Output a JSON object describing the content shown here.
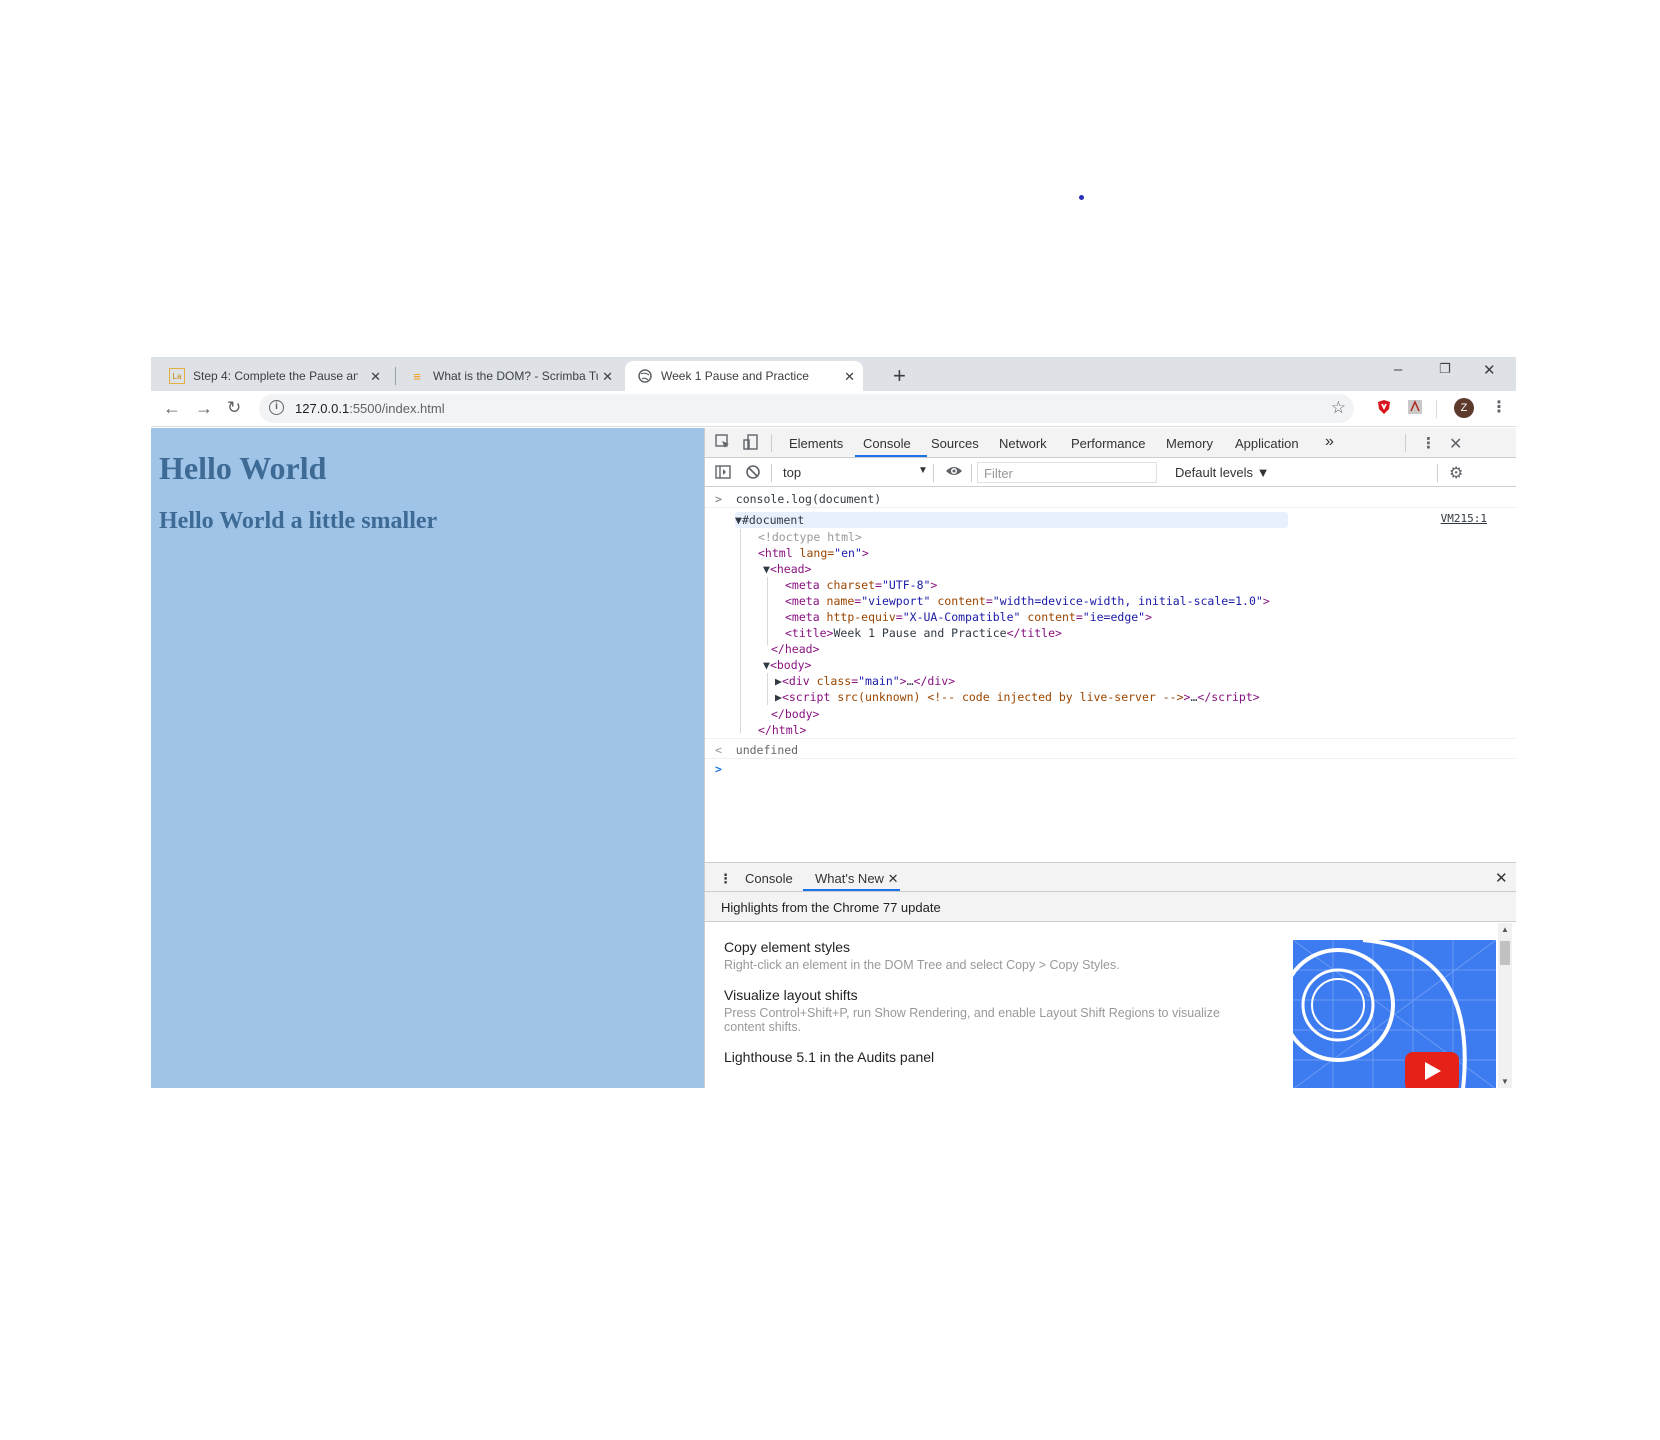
{
  "tabs": [
    {
      "title": "Step 4: Complete the Pause and Practice",
      "favicon": "la-icon"
    },
    {
      "title": "What is the DOM? - Scrimba Tutorial",
      "favicon": "scrimba-icon"
    },
    {
      "title": "Week 1 Pause and Practice",
      "favicon": "globe-icon"
    }
  ],
  "window_controls": {
    "minimize": "–",
    "restore": "❐",
    "close": "✕"
  },
  "omnibox": {
    "url_host": "127.0.0.1",
    "url_rest": ":5500/index.html"
  },
  "avatar_letter": "Z",
  "page": {
    "h1": "Hello World",
    "h2": "Hello World a little smaller"
  },
  "devtools": {
    "tabs": [
      "Elements",
      "Console",
      "Sources",
      "Network",
      "Performance",
      "Memory",
      "Application"
    ],
    "more": "»",
    "context": "top",
    "filter_placeholder": "Filter",
    "levels": "Default levels ▼",
    "source_link": "VM215:1",
    "command": "console.log(document)",
    "result": "undefined",
    "tree": {
      "document": "#document",
      "doctype": "<!doctype html>",
      "html_open_tag": "<html",
      "html_lang_attr": " lang=",
      "html_lang_val": "\"en\"",
      "head_open": "<head>",
      "meta_charset": "charset",
      "meta_charset_val": "\"UTF-8\"",
      "meta_name": "name",
      "meta_name_val": "\"viewport\"",
      "meta_content": "content",
      "meta_content_val": "\"width=device-width, initial-scale=1.0\"",
      "meta_http": "http-equiv",
      "meta_http_val": "\"X-UA-Compatible\"",
      "meta_http_content_val": "\"ie=edge\"",
      "title_text": "Week 1 Pause and Practice",
      "head_close": "</head>",
      "body_open": "<body>",
      "div_class": "class",
      "div_class_val": "\"main\"",
      "script_text": "src(unknown) <!-- code injected by live-server -->",
      "body_close": "</body>",
      "html_close": "</html>"
    }
  },
  "drawer": {
    "tabs": [
      "Console",
      "What's New"
    ],
    "highlights": "Highlights from the Chrome 77 update",
    "items": [
      {
        "title": "Copy element styles",
        "desc": "Right-click an element in the DOM Tree and select Copy > Copy Styles."
      },
      {
        "title": "Visualize layout shifts",
        "desc": "Press Control+Shift+P, run Show Rendering, and enable Layout Shift Regions to visualize content shifts."
      },
      {
        "title": "Lighthouse 5.1 in the Audits panel",
        "desc": ""
      }
    ]
  },
  "colors": {
    "page_bg": "#a0c4e8",
    "heading": "#3d6b96",
    "accent": "#1a73e8"
  }
}
